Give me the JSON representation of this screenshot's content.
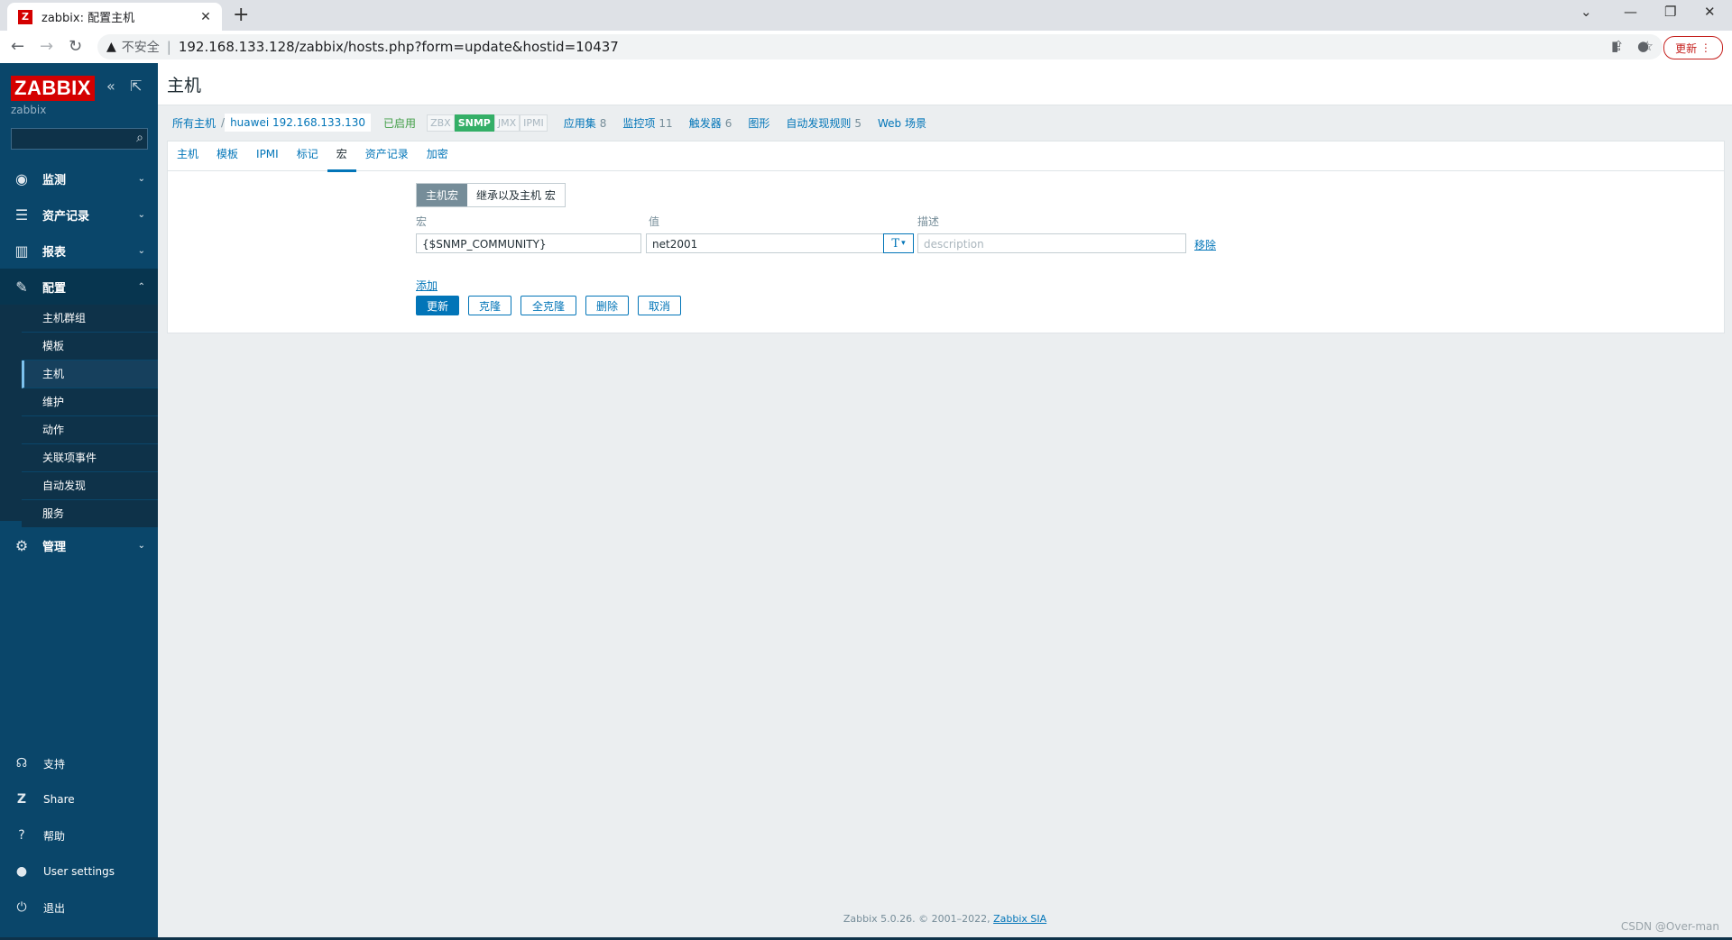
{
  "browser": {
    "tab_title": "zabbix: 配置主机",
    "favicon_letter": "Z",
    "insecure_label": "不安全",
    "url": "192.168.133.128/zabbix/hosts.php?form=update&hostid=10437",
    "update_label": "更新"
  },
  "sidebar": {
    "logo": "ZABBIX",
    "server_name": "zabbix",
    "menu": [
      {
        "label": "监测"
      },
      {
        "label": "资产记录"
      },
      {
        "label": "报表"
      },
      {
        "label": "配置"
      },
      {
        "label": "管理"
      }
    ],
    "config_submenu": [
      "主机群组",
      "模板",
      "主机",
      "维护",
      "动作",
      "关联项事件",
      "自动发现",
      "服务"
    ],
    "footer": [
      "支持",
      "Share",
      "帮助",
      "User settings",
      "退出"
    ]
  },
  "page": {
    "title": "主机",
    "breadcrumb": {
      "all_hosts": "所有主机",
      "host": "huawei 192.168.133.130"
    },
    "status": "已启用",
    "availability": [
      "ZBX",
      "SNMP",
      "JMX",
      "IPMI"
    ],
    "nav_links": [
      {
        "label": "应用集",
        "count": "8"
      },
      {
        "label": "监控项",
        "count": "11"
      },
      {
        "label": "触发器",
        "count": "6"
      },
      {
        "label": "图形",
        "count": ""
      },
      {
        "label": "自动发现规则",
        "count": "5"
      },
      {
        "label": "Web 场景",
        "count": ""
      }
    ],
    "tabs": [
      "主机",
      "模板",
      "IPMI",
      "标记",
      "宏",
      "资产记录",
      "加密"
    ],
    "active_tab": "宏",
    "macro_mode": [
      "主机宏",
      "继承以及主机 宏"
    ],
    "columns": {
      "macro": "宏",
      "value": "值",
      "description": "描述"
    },
    "macro_row": {
      "macro": "{$SNMP_COMMUNITY}",
      "value": "net2001",
      "type_glyph": "T",
      "description_placeholder": "description",
      "remove": "移除"
    },
    "add": "添加",
    "buttons": [
      "更新",
      "克隆",
      "全克隆",
      "删除",
      "取消"
    ]
  },
  "footer": {
    "text": "Zabbix 5.0.26. © 2001–2022,",
    "company": "Zabbix SIA"
  },
  "watermark": "CSDN @Over-man",
  "colors": {
    "sidebar_bg": "#0a466a",
    "accent": "#0275b8",
    "logo_red": "#d40000",
    "snmp_green": "#34af67"
  }
}
